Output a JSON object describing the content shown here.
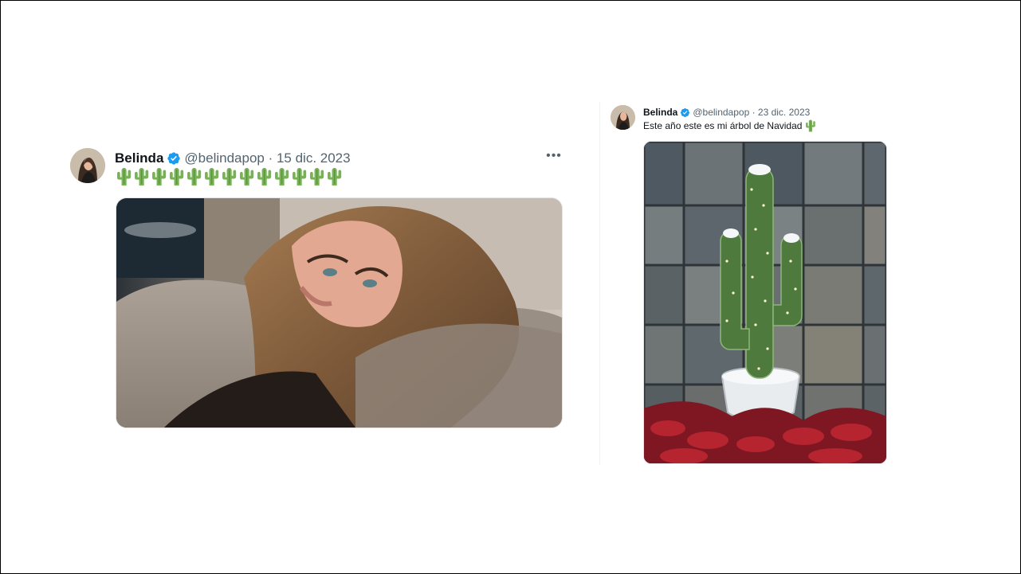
{
  "tweet_left": {
    "author_name": "Belinda",
    "handle_date": "@belindapop · 15 dic. 2023",
    "more_label": "•••",
    "emoji_text": "🌵🌵🌵🌵🌵🌵🌵🌵🌵🌵🌵🌵🌵",
    "emoji_icon": "cactus-icon",
    "emoji_count": 13,
    "media_icon": "photo-woman-lying-on-sofa"
  },
  "tweet_right": {
    "author_name": "Belinda",
    "handle_date": "@belindapop · 23 dic. 2023",
    "text": "Este año este es mi árbol de Navidad",
    "emoji_icon": "cactus-icon",
    "media_icon": "photo-cactus-christmas-tree"
  },
  "colors": {
    "verified": "#1d9bf0",
    "meta_text": "#536471",
    "cactus": "#77b255"
  }
}
